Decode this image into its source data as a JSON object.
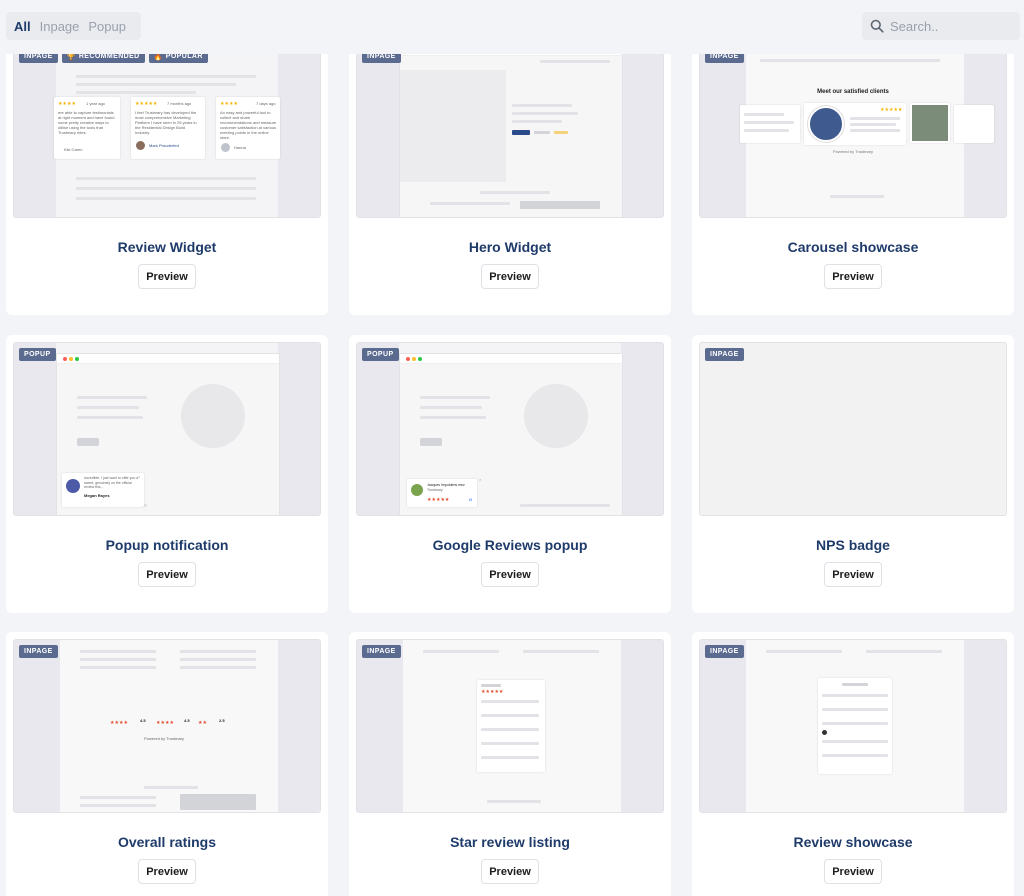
{
  "filters": {
    "all": "All",
    "inpage": "Inpage",
    "popup": "Popup"
  },
  "search": {
    "placeholder": "Search.."
  },
  "colors": {
    "badge": "#5b6b90",
    "title": "#1f3b6a",
    "stars": "#f4b400",
    "accent": "#2a4a8a"
  },
  "badges": {
    "inpage": "INPAGE",
    "popup": "POPUP",
    "recommended": "RECOMMENDED",
    "popular": "POPULAR"
  },
  "preview_label": "Preview",
  "cards": [
    {
      "title": "Review Widget"
    },
    {
      "title": "Hero Widget"
    },
    {
      "title": "Carousel showcase"
    },
    {
      "title": "Popup notification"
    },
    {
      "title": "Google Reviews popup"
    },
    {
      "title": "NPS badge"
    },
    {
      "title": "Overall ratings"
    },
    {
      "title": "Star review listing"
    },
    {
      "title": "Review showcase"
    }
  ],
  "thumb_text": {
    "review_widget": {
      "t1": "1 year ago",
      "t2": "7 months ago",
      "t3": "7 days ago",
      "r1": "ere able to capture testimonials at right moment and have found some pretty creative ways to utilise using the tools that Trustmary rides.",
      "r2": "I feel Trustmary has developed the most comprehensive Marketing Platform I have seen in 25 years in the Residential Design Build Industry.",
      "r3": "An easy and powerful tool to collect and share recommendations and measure customer satisfaction at various meeting points in the online store.",
      "n1": "Kiki Caren",
      "n2": "Mark Prouderfed",
      "n3": "Hanna"
    },
    "carousel": {
      "heading": "Meet our satisfied clients",
      "powered": "Powered by Trustmary"
    },
    "popup": {
      "name": "Megan Rayes",
      "text": "Incredible. I just want to offer you a sweet, genuinely on the official review this..."
    },
    "google": {
      "name": "Jacques Impuldens mez",
      "brand": "Trustmary"
    },
    "overall": {
      "powered": "Powered by Trustmary",
      "s1": "4.5",
      "s2": "4.5",
      "s3": "2.5"
    }
  }
}
